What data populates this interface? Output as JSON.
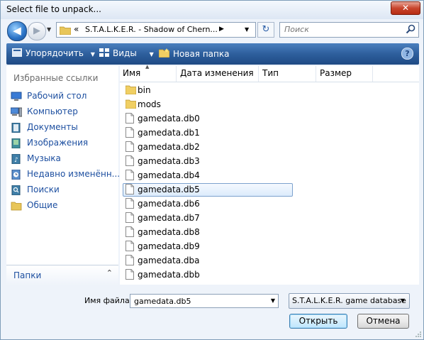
{
  "window": {
    "title": "Select file to unpack...",
    "close_glyph": "✕"
  },
  "nav": {
    "back_glyph": "◀",
    "forward_glyph": "▶",
    "address": {
      "chevron": "«",
      "path": "S.T.A.L.K.E.R. - Shadow of Chern...",
      "sep_glyph": "▶",
      "dropdown_glyph": "▼"
    },
    "refresh_glyph": "↻",
    "search": {
      "placeholder": "Поиск",
      "icon": "search-icon"
    }
  },
  "toolbar": {
    "organize_label": "Упорядочить",
    "views_label": "Виды",
    "new_folder_label": "Новая папка",
    "help_glyph": "?",
    "dropdown_glyph": "▼"
  },
  "sidebar": {
    "header": "Избранные ссылки",
    "items": [
      {
        "label": "Рабочий стол",
        "icon": "desktop-icon"
      },
      {
        "label": "Компьютер",
        "icon": "computer-icon"
      },
      {
        "label": "Документы",
        "icon": "documents-icon"
      },
      {
        "label": "Изображения",
        "icon": "pictures-icon"
      },
      {
        "label": "Музыка",
        "icon": "music-icon"
      },
      {
        "label": "Недавно изменённ...",
        "icon": "recent-icon"
      },
      {
        "label": "Поиски",
        "icon": "searches-icon"
      },
      {
        "label": "Общие",
        "icon": "public-folder-icon"
      }
    ],
    "folders_label": "Папки",
    "folders_caret": "⌃"
  },
  "filelist": {
    "columns": [
      "Имя",
      "Дата изменения",
      "Тип",
      "Размер"
    ],
    "sort_glyph": "▲",
    "items": [
      {
        "name": "bin",
        "kind": "folder"
      },
      {
        "name": "mods",
        "kind": "folder"
      },
      {
        "name": "gamedata.db0",
        "kind": "file"
      },
      {
        "name": "gamedata.db1",
        "kind": "file"
      },
      {
        "name": "gamedata.db2",
        "kind": "file"
      },
      {
        "name": "gamedata.db3",
        "kind": "file"
      },
      {
        "name": "gamedata.db4",
        "kind": "file"
      },
      {
        "name": "gamedata.db5",
        "kind": "file",
        "selected": true
      },
      {
        "name": "gamedata.db6",
        "kind": "file"
      },
      {
        "name": "gamedata.db7",
        "kind": "file"
      },
      {
        "name": "gamedata.db8",
        "kind": "file"
      },
      {
        "name": "gamedata.db9",
        "kind": "file"
      },
      {
        "name": "gamedata.dba",
        "kind": "file"
      },
      {
        "name": "gamedata.dbb",
        "kind": "file"
      }
    ]
  },
  "footer": {
    "filename_label": "Имя файла:",
    "filename_value": "gamedata.db5",
    "filter_value": "S.T.A.L.K.E.R. game database",
    "dropdown_glyph": "▼",
    "open_label": "Открыть",
    "cancel_label": "Отмена"
  },
  "colors": {
    "toolbar": "#2e5f9d",
    "link": "#1d4fa0",
    "selection": "#dcebfc",
    "close_button": "#c9452d"
  }
}
